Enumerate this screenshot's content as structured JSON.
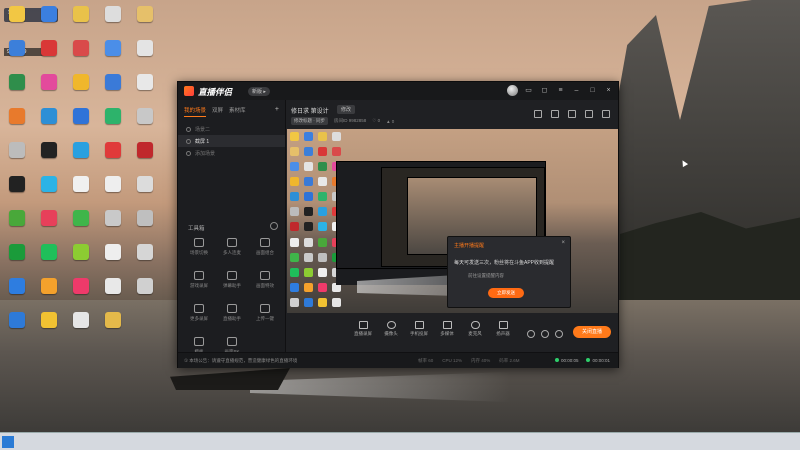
{
  "desktop": {
    "badge_top": "SIDE",
    "badge_sub": "9882839",
    "icons": [
      {
        "label": "",
        "color": "#f2c744"
      },
      {
        "label": "",
        "color": "#3b7fe0"
      },
      {
        "label": "",
        "color": "#e9c24a"
      },
      {
        "label": "",
        "color": "#dddddd"
      },
      {
        "label": "",
        "color": "#e6c06a"
      },
      {
        "label": "",
        "color": "#3c7fda"
      },
      {
        "label": "",
        "color": "#d93737"
      },
      {
        "label": "",
        "color": "#d94a4a"
      },
      {
        "label": "",
        "color": "#4b8ee8"
      },
      {
        "label": "",
        "color": "#e4e4e4"
      },
      {
        "label": "",
        "color": "#2f8e4b"
      },
      {
        "label": "",
        "color": "#e34a9c"
      },
      {
        "label": "",
        "color": "#f0b72c"
      },
      {
        "label": "",
        "color": "#3a7ad8"
      },
      {
        "label": "",
        "color": "#e8e8e8"
      },
      {
        "label": "",
        "color": "#e87a2c"
      },
      {
        "label": "",
        "color": "#2d8fd6"
      },
      {
        "label": "",
        "color": "#2f73d8"
      },
      {
        "label": "",
        "color": "#2db36b"
      },
      {
        "label": "",
        "color": "#c8c8c8"
      },
      {
        "label": "",
        "color": "#bcbcbc"
      },
      {
        "label": "",
        "color": "#222222"
      },
      {
        "label": "",
        "color": "#29a0e0"
      },
      {
        "label": "",
        "color": "#e03a3a"
      },
      {
        "label": "",
        "color": "#c0282c"
      },
      {
        "label": "",
        "color": "#222222"
      },
      {
        "label": "",
        "color": "#2bb3e6"
      },
      {
        "label": "",
        "color": "#f0f0f0"
      },
      {
        "label": "",
        "color": "#eeeeee"
      },
      {
        "label": "",
        "color": "#dcdcdc"
      },
      {
        "label": "",
        "color": "#49a83a"
      },
      {
        "label": "",
        "color": "#e7405a"
      },
      {
        "label": "",
        "color": "#3fb54a"
      },
      {
        "label": "",
        "color": "#c9c9c9"
      },
      {
        "label": "",
        "color": "#bfbfbf"
      },
      {
        "label": "",
        "color": "#1a9b3a"
      },
      {
        "label": "",
        "color": "#1fbf5a"
      },
      {
        "label": "",
        "color": "#8ccc32"
      },
      {
        "label": "",
        "color": "#eeeeee"
      },
      {
        "label": "",
        "color": "#d6d6d6"
      },
      {
        "label": "",
        "color": "#2e7de0"
      },
      {
        "label": "",
        "color": "#f4a12c"
      },
      {
        "label": "",
        "color": "#ee3a6a"
      },
      {
        "label": "",
        "color": "#e8e8e8"
      },
      {
        "label": "",
        "color": "#d0d0d0"
      },
      {
        "label": "",
        "color": "#2e7ad8"
      },
      {
        "label": "",
        "color": "#f1c232"
      },
      {
        "label": "",
        "color": "#e6e6e6"
      },
      {
        "label": "",
        "color": "#e4b94a"
      }
    ]
  },
  "app": {
    "title": "直播伴侣",
    "version_label": "新版 ▸",
    "sidebar": {
      "tabs": [
        "我的场景",
        "双屏",
        "素材库"
      ],
      "add_label": "+",
      "scenes": [
        "场景二",
        "截屏 1",
        "添加场景"
      ],
      "tools_title": "工具箱",
      "tools": [
        {
          "label": "场景切换"
        },
        {
          "label": "多人连麦"
        },
        {
          "label": "画面组合"
        },
        {
          "label": "游戏录屏"
        },
        {
          "label": "弹幕助手"
        },
        {
          "label": "画面特效"
        },
        {
          "label": "更多录屏"
        },
        {
          "label": "直播助手"
        },
        {
          "label": "上传一键"
        },
        {
          "label": "模板"
        },
        {
          "label": "画面PK"
        }
      ]
    },
    "room": {
      "title": "修日求 第设计",
      "tag": "修改",
      "sub_pill": "修改标题 · 同步",
      "sub_id": "房间ID 9982858",
      "sub_stats": [
        "♡ 0",
        "▲ 0"
      ]
    },
    "dialog": {
      "title": "主播开播提醒",
      "message": "每天可发送三次，粉丝将在斗鱼APP收到提醒",
      "sub": "前往设置提醒内容",
      "button": "立即发送"
    },
    "controls": [
      {
        "label": "直播录屏"
      },
      {
        "label": "摄像头"
      },
      {
        "label": "手机投屏"
      },
      {
        "label": "多媒体"
      },
      {
        "label": "麦克风"
      },
      {
        "label": "扬声器"
      }
    ],
    "go_live_label": "关闭直播",
    "status": {
      "message": "① 本场公告：请遵守直播规范，营造健康绿色的直播环境",
      "stats": [
        "帧率 60",
        "CPU 12%",
        "内存 40%",
        "码率 2.6M"
      ],
      "time1": "00:00:05",
      "time2": "00:00:01"
    }
  },
  "taskbar": {
    "start": ""
  }
}
